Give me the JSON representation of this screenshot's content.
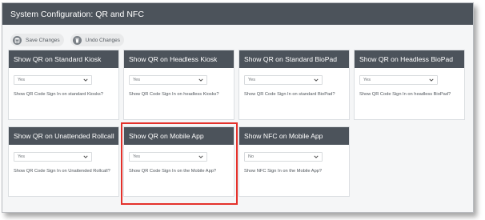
{
  "page": {
    "title": "System Configuration: QR and NFC"
  },
  "toolbar": {
    "save_label": "Save Changes",
    "undo_label": "Undo Changes"
  },
  "cards": [
    {
      "title": "Show QR on Standard Kiosk",
      "value": "Yes",
      "description": "Show QR Code Sign In on standard Kiosks?"
    },
    {
      "title": "Show QR on Headless Kiosk",
      "value": "Yes",
      "description": "Show QR Code Sign In on headless Kiosks?"
    },
    {
      "title": "Show QR on Standard BioPad",
      "value": "Yes",
      "description": "Show QR Code Sign In on standard BioPad?"
    },
    {
      "title": "Show QR on Headless BioPad",
      "value": "Yes",
      "description": "Show QR Code Sign In on headless BioPad?"
    },
    {
      "title": "Show QR on Unattended Rollcall",
      "value": "Yes",
      "description": "Show QR Code Sign In on Unattended Rollcall?"
    },
    {
      "title": "Show QR on Mobile App",
      "value": "Yes",
      "description": "Show QR Code Sign In on the Mobile App?"
    },
    {
      "title": "Show NFC on Mobile App",
      "value": "No",
      "description": "Show NFC Sign In on the Mobile App?"
    }
  ],
  "colors": {
    "header_bg": "#4c535b",
    "highlight": "#e4312b"
  },
  "icons": {
    "save": "database-icon",
    "undo": "trash-icon",
    "select": "chevron-down-icon"
  }
}
